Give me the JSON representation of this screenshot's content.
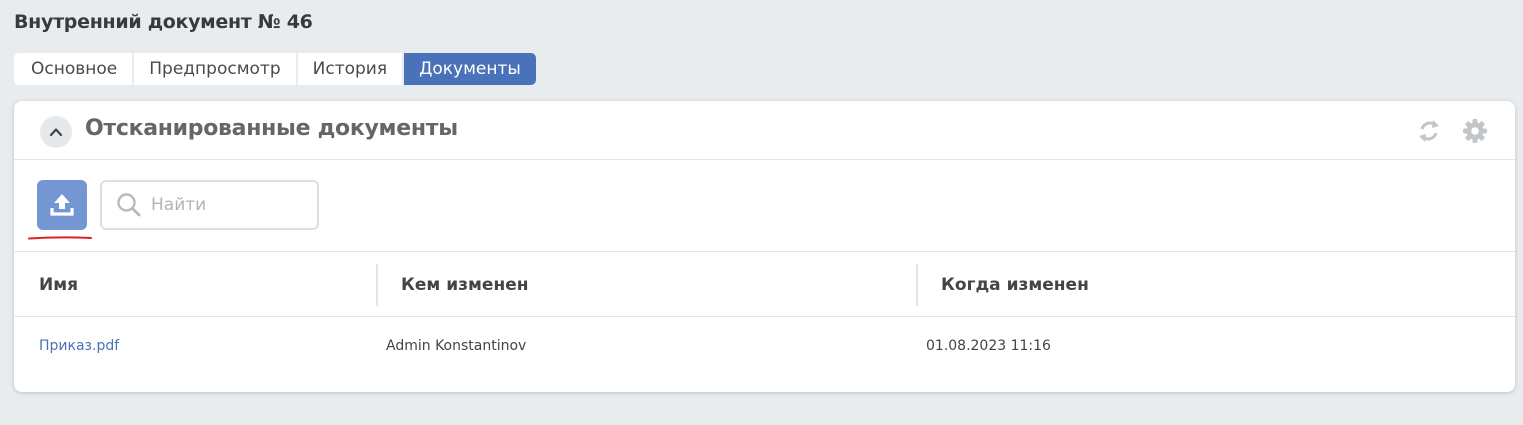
{
  "page": {
    "title": "Внутренний документ № 46"
  },
  "tabs": [
    {
      "label": "Основное",
      "active": false
    },
    {
      "label": "Предпросмотр",
      "active": false
    },
    {
      "label": "История",
      "active": false
    },
    {
      "label": "Документы",
      "active": true
    }
  ],
  "panel": {
    "title": "Отсканированные документы",
    "icons": {
      "collapse": "chevron-up-icon",
      "refresh": "refresh-icon",
      "settings": "gear-icon"
    }
  },
  "toolbar": {
    "upload_icon": "upload-icon",
    "search_placeholder": "Найти",
    "search_value": ""
  },
  "table": {
    "columns": [
      "Имя",
      "Кем изменен",
      "Когда изменен"
    ],
    "rows": [
      [
        "Приказ.pdf",
        "Admin Konstantinov",
        "01.08.2023 11:16"
      ]
    ]
  },
  "colors": {
    "accent": "#4a72b8",
    "upload_button": "#7496d2",
    "annotation_underline": "#e02020",
    "background": "#e8ecef"
  }
}
